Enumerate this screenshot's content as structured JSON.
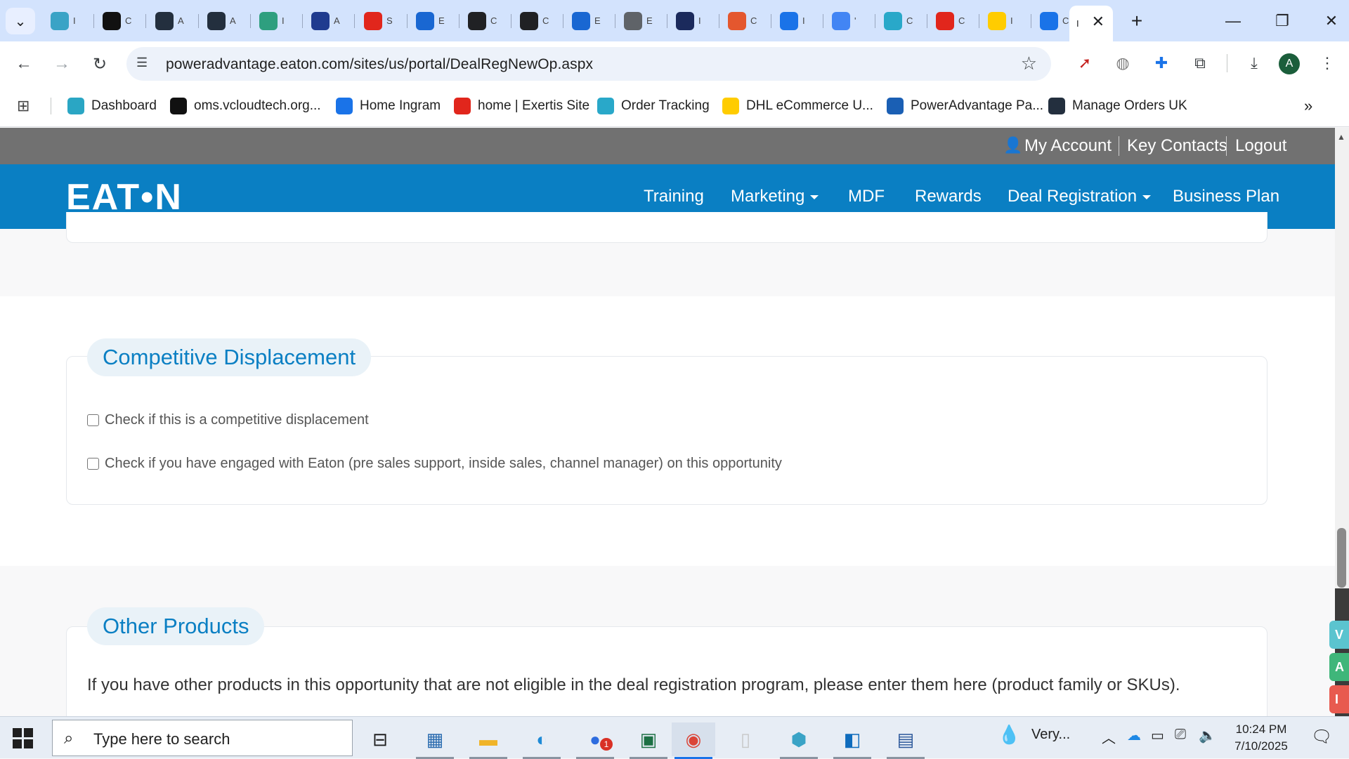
{
  "browser": {
    "tabs": [
      {
        "icon": "chatgpt-alt-icon",
        "title": "I",
        "color": "#3aa3c6"
      },
      {
        "icon": "triangle-logo-icon",
        "title": "C",
        "color": "#111111"
      },
      {
        "icon": "amazon-icon",
        "title": "A",
        "color": "#232f3e"
      },
      {
        "icon": "amazon-icon",
        "title": "A",
        "color": "#232f3e"
      },
      {
        "icon": "teal-cursor-icon",
        "title": "I",
        "color": "#2e9f7f"
      },
      {
        "icon": "play-arrow-icon",
        "title": "A",
        "color": "#1f3b8f"
      },
      {
        "icon": "exertis-icon",
        "title": "S",
        "color": "#e1261c"
      },
      {
        "icon": "e-logo-icon",
        "title": "E",
        "color": "#1967d2"
      },
      {
        "icon": "openai-icon",
        "title": "C",
        "color": "#202124"
      },
      {
        "icon": "openai-icon",
        "title": "C",
        "color": "#202124"
      },
      {
        "icon": "e-logo-icon",
        "title": "E",
        "color": "#1967d2"
      },
      {
        "icon": "lightbulb-icon",
        "title": "E",
        "color": "#5f6368"
      },
      {
        "icon": "qu-logo-icon",
        "title": "I",
        "color": "#1b2a5c"
      },
      {
        "icon": "s-logo-icon",
        "title": "C",
        "color": "#e4572e"
      },
      {
        "icon": "arrow-logo-icon",
        "title": "I",
        "color": "#1a73e8"
      },
      {
        "icon": "google-icon",
        "title": "'",
        "color": "#4285f4"
      },
      {
        "icon": "c-circle-icon",
        "title": "C",
        "color": "#29a8c9"
      },
      {
        "icon": "exertis-icon",
        "title": "C",
        "color": "#e1261c"
      },
      {
        "icon": "dhl-icon",
        "title": "I",
        "color": "#ffcc00"
      },
      {
        "icon": "etn-icon",
        "title": "C",
        "color": "#1a73e8"
      }
    ],
    "active_tab_title": "I",
    "url": "poweradvantage.eaton.com/sites/us/portal/DealRegNewOp.aspx",
    "avatar_letter": "A",
    "bookmarks": [
      {
        "icon": "dashboard-icon",
        "label": "Dashboard",
        "color": "#2aa6c4"
      },
      {
        "icon": "triangle-logo-icon",
        "label": "oms.vcloudtech.org...",
        "color": "#111111"
      },
      {
        "icon": "ingram-icon",
        "label": "Home Ingram",
        "color": "#1a73e8"
      },
      {
        "icon": "exertis-icon",
        "label": "home | Exertis Site",
        "color": "#e1261c"
      },
      {
        "icon": "c-circle-icon",
        "label": "Order Tracking",
        "color": "#29a8c9"
      },
      {
        "icon": "dhl-icon",
        "label": "DHL eCommerce U...",
        "color": "#ffcc00"
      },
      {
        "icon": "f-logo-icon",
        "label": "PowerAdvantage Pa...",
        "color": "#1a5fb4"
      },
      {
        "icon": "amazon-icon",
        "label": "Manage Orders UK",
        "color": "#232f3e"
      }
    ]
  },
  "site": {
    "util_links": {
      "my_account": "My Account",
      "key_contacts": "Key Contacts",
      "logout": "Logout"
    },
    "logo_text": "EAT•N",
    "nav": {
      "training": "Training",
      "marketing": "Marketing",
      "mdf": "MDF",
      "rewards": "Rewards",
      "deal_registration": "Deal Registration",
      "business_plan": "Business Plan"
    },
    "colors": {
      "brand_blue": "#0a7fc3",
      "util_gray": "#717171",
      "pill_bg": "#e9f2f8"
    }
  },
  "competitive": {
    "title": "Competitive Displacement",
    "checkbox1": "Check if this is a competitive displacement",
    "checkbox2": "Check if you have engaged with Eaton (pre sales support, inside sales, channel manager) on this opportunity",
    "checkbox1_checked": false,
    "checkbox2_checked": false
  },
  "other_products": {
    "title": "Other Products",
    "description": "If you have other products in this opportunity that are not eligible in the deal registration program, please enter them here (product family or SKUs)."
  },
  "side_tabs": [
    {
      "label": "V",
      "color": "#5bc4cf"
    },
    {
      "label": "A",
      "color": "#3fb67a"
    },
    {
      "label": "I",
      "color": "#e85a4f"
    }
  ],
  "taskbar": {
    "search_placeholder": "Type here to search",
    "weather": "Very...",
    "time": "10:24 PM",
    "date": "7/10/2025",
    "zoom_badge": "1"
  }
}
